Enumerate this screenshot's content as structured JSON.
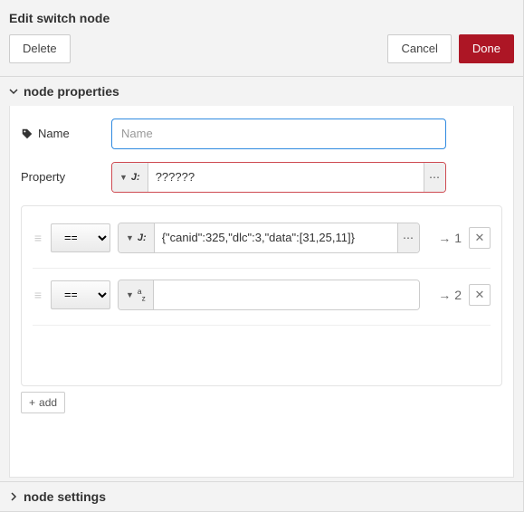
{
  "header": {
    "title": "Edit switch node"
  },
  "buttons": {
    "delete": "Delete",
    "cancel": "Cancel",
    "done": "Done"
  },
  "sections": {
    "properties": "node properties",
    "settings": "node settings"
  },
  "form": {
    "name_label": "Name",
    "name_value": "",
    "name_placeholder": "Name",
    "property_label": "Property",
    "property_type": "J:",
    "property_value": "??????"
  },
  "rules": [
    {
      "op": "==",
      "value_type": "J:",
      "value": "{\"canid\":325,\"dlc\":3,\"data\":[31,25,11]}",
      "has_expand": true,
      "out": "1"
    },
    {
      "op": "==",
      "value_type": "az",
      "value": "",
      "has_expand": false,
      "out": "2"
    }
  ],
  "add_label": "add"
}
